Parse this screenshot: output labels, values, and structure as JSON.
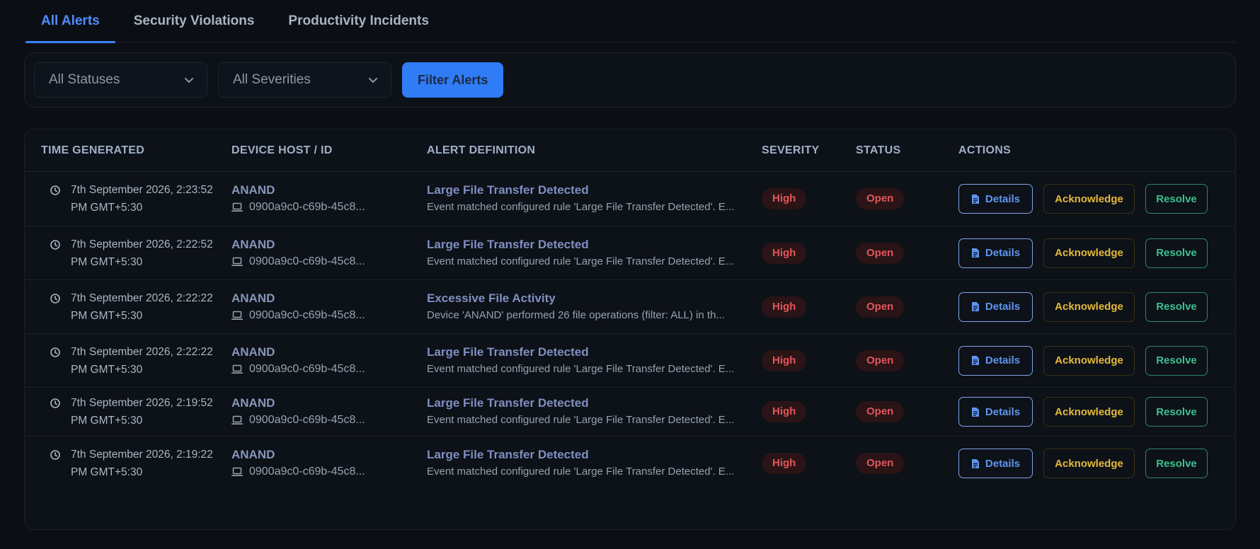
{
  "tabs": [
    {
      "label": "All Alerts",
      "active": true
    },
    {
      "label": "Security Violations",
      "active": false
    },
    {
      "label": "Productivity Incidents",
      "active": false
    }
  ],
  "filters": {
    "status_select": "All Statuses",
    "severity_select": "All Severities",
    "filter_button": "Filter Alerts"
  },
  "table": {
    "headers": {
      "time": "TIME GENERATED",
      "device": "DEVICE HOST / ID",
      "definition": "ALERT DEFINITION",
      "severity": "SEVERITY",
      "status": "STATUS",
      "actions": "ACTIONS"
    },
    "action_labels": {
      "details": "Details",
      "acknowledge": "Acknowledge",
      "resolve": "Resolve"
    },
    "rows": [
      {
        "time_line1": "7th September 2026, 2:23:52",
        "time_line2": "PM GMT+5:30",
        "host": "ANAND",
        "device_id": "0900a9c0-c69b-45c8...",
        "title": "Large File Transfer Detected",
        "desc": "Event matched configured rule 'Large File Transfer Detected'. E...",
        "severity": "High",
        "status": "Open"
      },
      {
        "time_line1": "7th September 2026, 2:22:52",
        "time_line2": "PM GMT+5:30",
        "host": "ANAND",
        "device_id": "0900a9c0-c69b-45c8...",
        "title": "Large File Transfer Detected",
        "desc": "Event matched configured rule 'Large File Transfer Detected'. E...",
        "severity": "High",
        "status": "Open"
      },
      {
        "time_line1": "7th September 2026, 2:22:22",
        "time_line2": "PM GMT+5:30",
        "host": "ANAND",
        "device_id": "0900a9c0-c69b-45c8...",
        "title": "Excessive File Activity",
        "desc": "Device 'ANAND' performed 26 file operations (filter: ALL) in th...",
        "severity": "High",
        "status": "Open"
      },
      {
        "time_line1": "7th September 2026, 2:22:22",
        "time_line2": "PM GMT+5:30",
        "host": "ANAND",
        "device_id": "0900a9c0-c69b-45c8...",
        "title": "Large File Transfer Detected",
        "desc": "Event matched configured rule 'Large File Transfer Detected'. E...",
        "severity": "High",
        "status": "Open"
      },
      {
        "time_line1": "7th September 2026, 2:19:52",
        "time_line2": "PM GMT+5:30",
        "host": "ANAND",
        "device_id": "0900a9c0-c69b-45c8...",
        "title": "Large File Transfer Detected",
        "desc": "Event matched configured rule 'Large File Transfer Detected'. E...",
        "severity": "High",
        "status": "Open"
      },
      {
        "time_line1": "7th September 2026, 2:19:22",
        "time_line2": "PM GMT+5:30",
        "host": "ANAND",
        "device_id": "0900a9c0-c69b-45c8...",
        "title": "Large File Transfer Detected",
        "desc": "Event matched configured rule 'Large File Transfer Detected'. E...",
        "severity": "High",
        "status": "Open"
      }
    ]
  },
  "icons": {
    "select_chevron": "chevron-down-icon",
    "time": "clock-icon",
    "device": "laptop-icon",
    "details": "document-icon"
  },
  "colors": {
    "background": "#0b0f15",
    "accent": "#3b82f6",
    "severity_high": "#e2565b",
    "acknowledge": "#e5b93a",
    "resolve": "#3ec08f"
  }
}
